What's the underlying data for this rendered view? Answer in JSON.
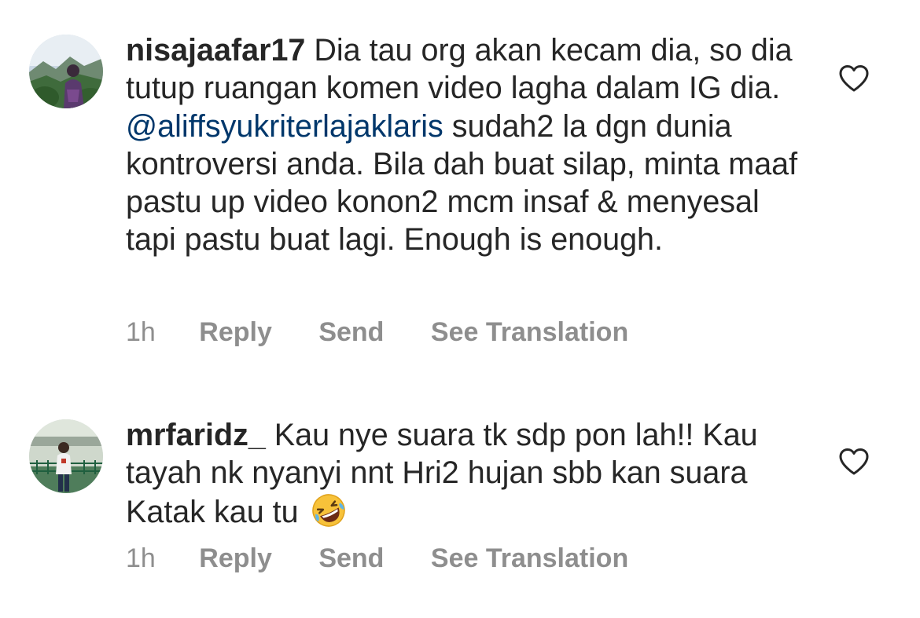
{
  "colors": {
    "text": "#262626",
    "secondary": "#8e8e8e",
    "mention": "#00376b"
  },
  "comments": [
    {
      "username": "nisajaafar17",
      "text_before_mention": "Dia tau org akan kecam dia, so dia tutup ruangan komen video lagha dalam IG dia.",
      "mention": "@aliffsyukriterlajaklaris",
      "text_after_mention": "sudah2 la dgn dunia kontroversi anda. Bila dah buat silap, minta maaf pastu up video konon2 mcm insaf & menyesal tapi pastu buat lagi. Enough is enough.",
      "time": "1h",
      "reply_label": "Reply",
      "send_label": "Send",
      "translate_label": "See Translation",
      "like_icon": "heart-outline-icon"
    },
    {
      "username": "mrfaridz_",
      "text": "Kau nye suara tk sdp pon lah!! Kau tayah nk nyanyi nnt Hri2 hujan sbb kan suara Katak kau tu",
      "emoji": "rolling-on-floor-laughing-emoji",
      "time": "1h",
      "reply_label": "Reply",
      "send_label": "Send",
      "translate_label": "See Translation",
      "like_icon": "heart-outline-icon"
    }
  ]
}
